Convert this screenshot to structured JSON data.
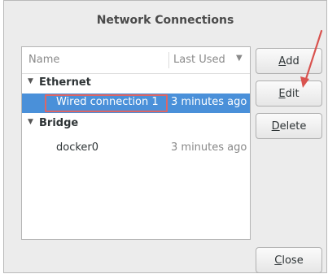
{
  "window": {
    "title": "Network Connections"
  },
  "list": {
    "columns": {
      "name": "Name",
      "last_used": "Last Used"
    },
    "groups": [
      {
        "label": "Ethernet",
        "items": [
          {
            "name": "Wired connection 1",
            "last_used": "3 minutes ago",
            "selected": true
          }
        ]
      },
      {
        "label": "Bridge",
        "items": [
          {
            "name": "docker0",
            "last_used": "3 minutes ago",
            "selected": false
          }
        ]
      }
    ]
  },
  "buttons": {
    "add": {
      "mnemonic": "A",
      "rest": "dd"
    },
    "edit": {
      "mnemonic": "E",
      "rest": "dit"
    },
    "delete": {
      "mnemonic": "D",
      "rest": "elete"
    },
    "close": {
      "mnemonic": "C",
      "rest": "lose"
    }
  },
  "colors": {
    "selection": "#4a90d9",
    "annotation": "#d9534f"
  },
  "icons": {
    "expander": "triangle-down-icon",
    "sort": "sort-desc-icon"
  }
}
